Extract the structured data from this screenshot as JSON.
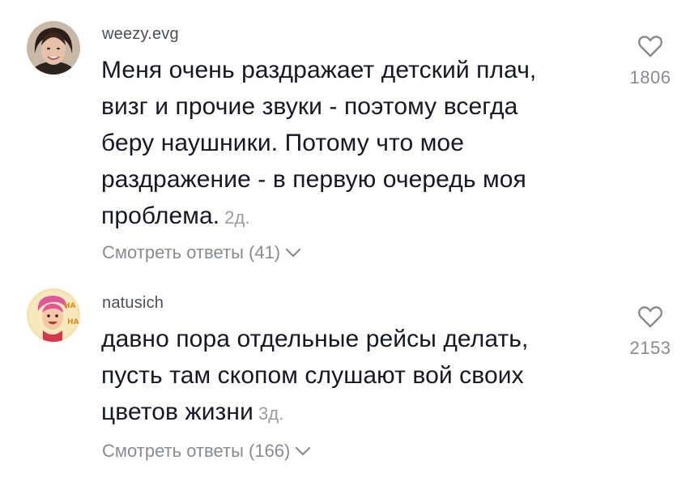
{
  "comments": [
    {
      "username": "weezy.evg",
      "text_lines": [
        "Меня очень раздражает детский плач,",
        "визг и прочие звуки - поэтому всегда",
        "беру наушники. Потому что мое",
        "раздражение - в первую очередь моя",
        "проблема."
      ],
      "timestamp": "2д.",
      "replies_label": "Смотреть ответы (41)",
      "likes": "1806",
      "icons": {
        "like": "heart-outline-icon",
        "expand": "chevron-down-icon"
      }
    },
    {
      "username": "natusich",
      "text_lines": [
        "давно пора отдельные рейсы делать,",
        "пусть там скопом слушают вой своих",
        "цветов жизни"
      ],
      "timestamp": "3д.",
      "replies_label": "Смотреть ответы (166)",
      "likes": "2153",
      "icons": {
        "like": "heart-outline-icon",
        "expand": "chevron-down-icon"
      }
    }
  ],
  "colors": {
    "text": "#161823",
    "username": "#4d4f57",
    "muted": "#8a8b91",
    "background": "#ffffff"
  }
}
